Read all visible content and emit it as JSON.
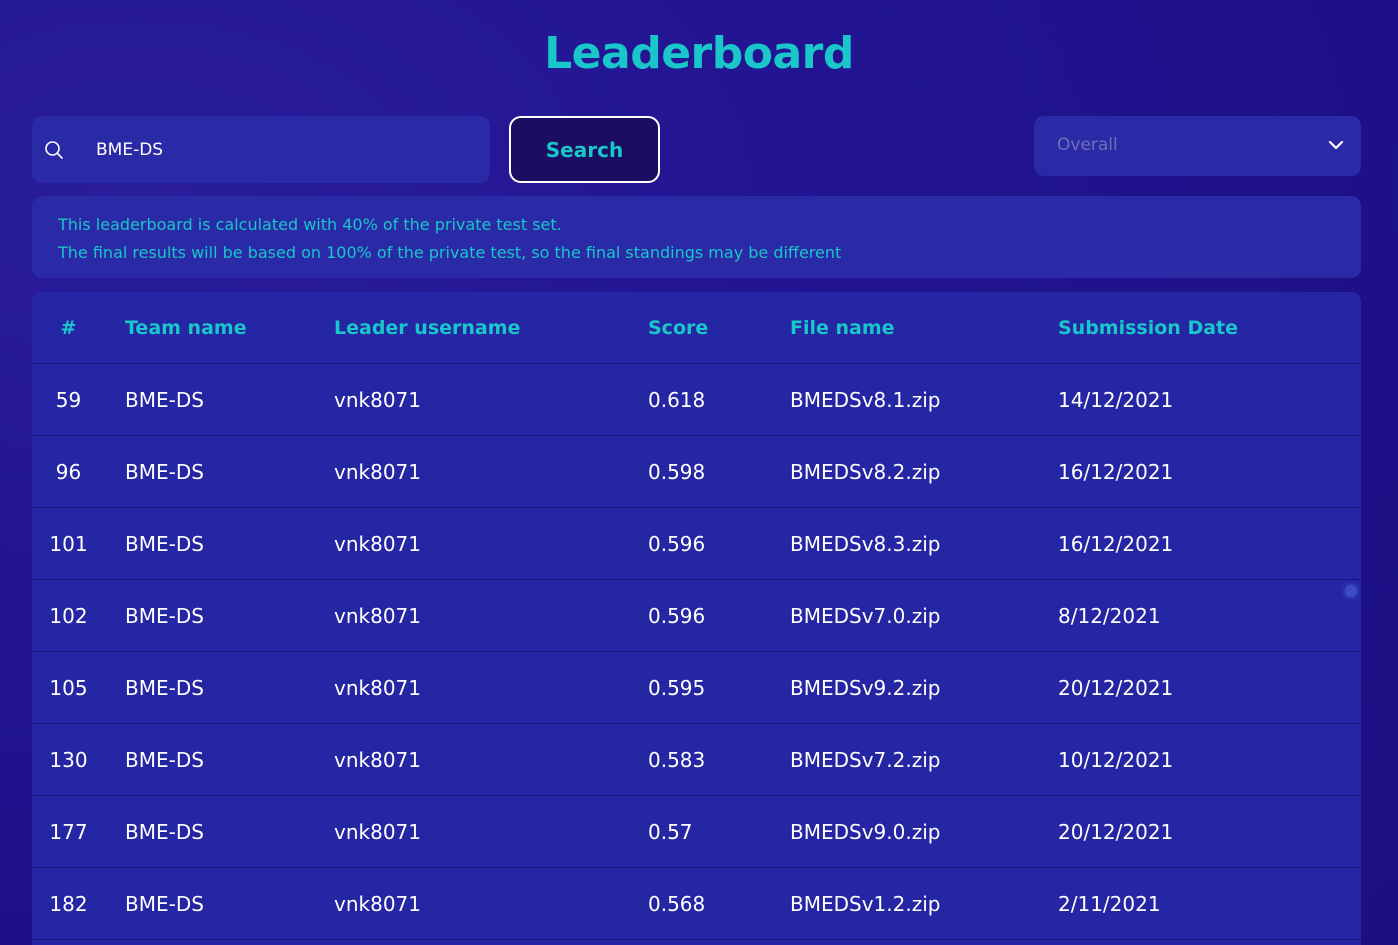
{
  "page": {
    "title": "Leaderboard"
  },
  "search": {
    "value": "BME-DS",
    "button_label": "Search",
    "icon": "search-icon"
  },
  "filter": {
    "selected": "Overall",
    "icon": "chevron-down-icon"
  },
  "notice": {
    "line1": "This leaderboard is calculated with 40% of the private test set.",
    "line2": "The final results will be based on 100% of the private test, so the final standings may be different"
  },
  "table": {
    "headers": {
      "rank": "#",
      "team": "Team name",
      "leader": "Leader username",
      "score": "Score",
      "file": "File name",
      "date": "Submission Date"
    },
    "rows": [
      {
        "rank": "59",
        "team": "BME-DS",
        "leader": "vnk8071",
        "score": "0.618",
        "file": "BMEDSv8.1.zip",
        "date": "14/12/2021"
      },
      {
        "rank": "96",
        "team": "BME-DS",
        "leader": "vnk8071",
        "score": "0.598",
        "file": "BMEDSv8.2.zip",
        "date": "16/12/2021"
      },
      {
        "rank": "101",
        "team": "BME-DS",
        "leader": "vnk8071",
        "score": "0.596",
        "file": "BMEDSv8.3.zip",
        "date": "16/12/2021"
      },
      {
        "rank": "102",
        "team": "BME-DS",
        "leader": "vnk8071",
        "score": "0.596",
        "file": "BMEDSv7.0.zip",
        "date": "8/12/2021"
      },
      {
        "rank": "105",
        "team": "BME-DS",
        "leader": "vnk8071",
        "score": "0.595",
        "file": "BMEDSv9.2.zip",
        "date": "20/12/2021"
      },
      {
        "rank": "130",
        "team": "BME-DS",
        "leader": "vnk8071",
        "score": "0.583",
        "file": "BMEDSv7.2.zip",
        "date": "10/12/2021"
      },
      {
        "rank": "177",
        "team": "BME-DS",
        "leader": "vnk8071",
        "score": "0.57",
        "file": "BMEDSv9.0.zip",
        "date": "20/12/2021"
      },
      {
        "rank": "182",
        "team": "BME-DS",
        "leader": "vnk8071",
        "score": "0.568",
        "file": "BMEDSv1.2.zip",
        "date": "2/11/2021"
      }
    ]
  },
  "colors": {
    "accent": "#19c6c9",
    "panel": "#2b2aa6",
    "background": "#221491"
  }
}
